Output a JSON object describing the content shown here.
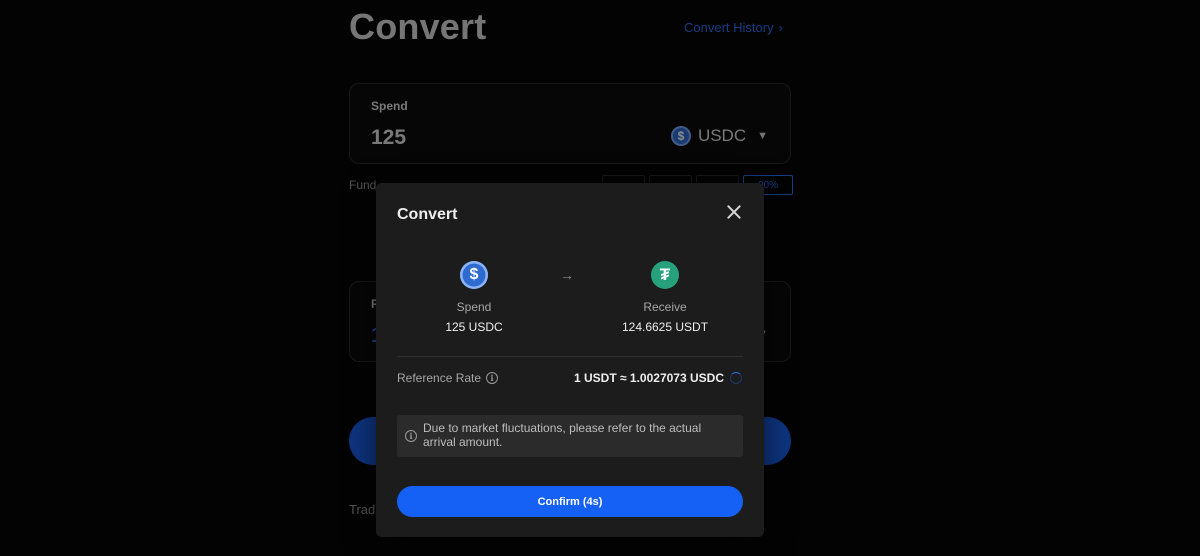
{
  "page": {
    "title": "Convert",
    "history_link": "Convert History",
    "spend_card": {
      "label": "Spend",
      "amount": "125",
      "currency": "USDC"
    },
    "funds_text": "Fund",
    "percent_buttons": [
      "",
      "",
      "",
      "00%"
    ],
    "receive_card": {
      "label": "R",
      "amount": "1"
    },
    "footer_text": "Trad"
  },
  "modal": {
    "title": "Convert",
    "spend": {
      "label": "Spend",
      "value": "125 USDC",
      "icon": "usdc-coin-icon"
    },
    "receive": {
      "label": "Receive",
      "value": "124.6625 USDT",
      "icon": "usdt-coin-icon"
    },
    "arrow": "→",
    "rate_label": "Reference Rate",
    "rate_value": "1 USDT ≈ 1.0027073 USDC",
    "notice": "Due to market fluctuations, please refer to the actual arrival amount.",
    "confirm_label": "Confirm (4s)"
  },
  "colors": {
    "accent": "#1560f5",
    "usdc": "#2e6bd0",
    "usdt": "#26a17b",
    "modal_bg": "#1c1c1d"
  }
}
